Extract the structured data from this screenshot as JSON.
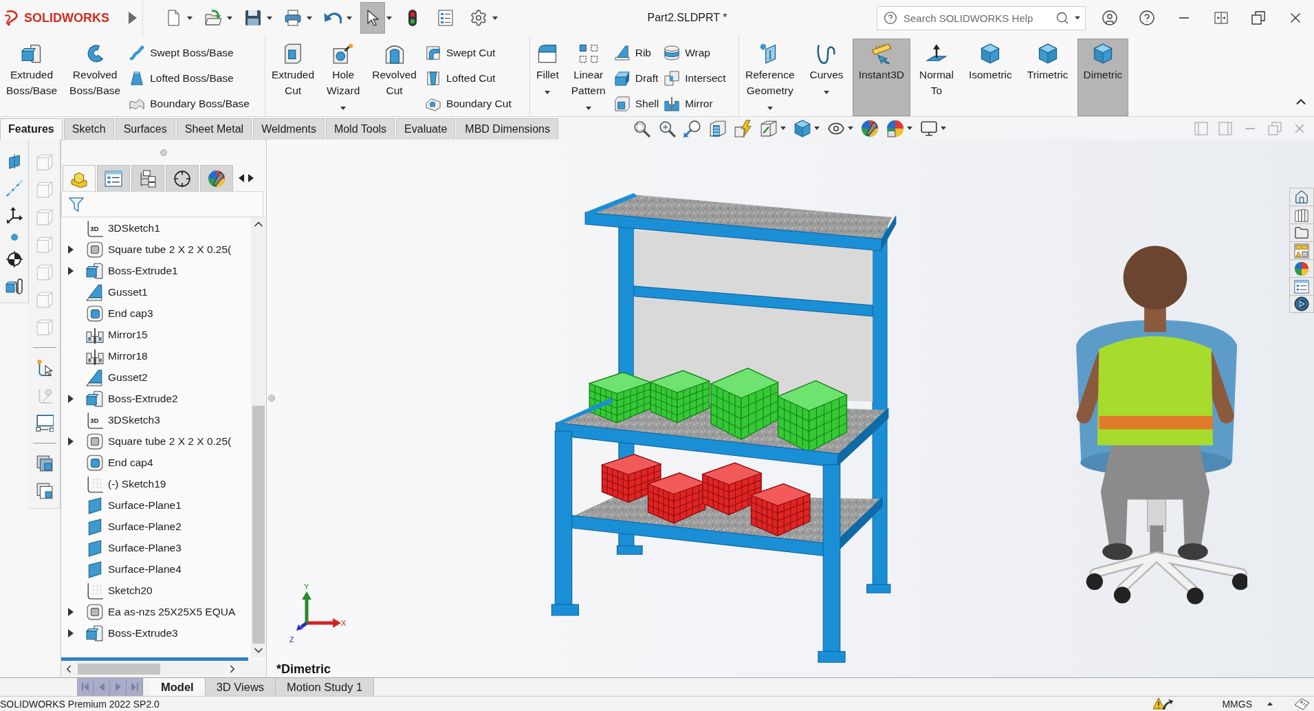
{
  "title_bar": {
    "logo": "SOLIDWORKS",
    "quick_access": [
      {
        "dropdown": true,
        "selected": false
      },
      {
        "dropdown": true,
        "selected": false
      },
      {
        "dropdown": true,
        "selected": false
      },
      {
        "dropdown": true,
        "selected": false
      },
      {
        "dropdown": true,
        "selected": false
      },
      {
        "dropdown": true,
        "selected": true
      },
      {
        "dropdown": false,
        "selected": false
      },
      {
        "dropdown": false,
        "selected": false
      },
      {
        "dropdown": true,
        "selected": false
      }
    ],
    "title": "Part2.SLDPRT *",
    "search": {
      "placeholder": "Search SOLIDWORKS Help"
    }
  },
  "ribbon": {
    "groups": [
      {
        "tools": [
          {
            "kind": "large",
            "label": "Extruded Boss/Base",
            "dropdown": false,
            "selected": false
          },
          {
            "kind": "large",
            "label": "Revolved Boss/Base",
            "dropdown": false,
            "selected": false
          },
          {
            "kind": "stack",
            "items": [
              {
                "label": "Swept Boss/Base"
              },
              {
                "label": "Lofted Boss/Base"
              },
              {
                "label": "Boundary Boss/Base"
              }
            ]
          }
        ]
      },
      {
        "tools": [
          {
            "kind": "large",
            "label": "Extruded Cut",
            "dropdown": false,
            "selected": false
          },
          {
            "kind": "large",
            "label": "Hole Wizard",
            "dropdown": true,
            "selected": false
          },
          {
            "kind": "large",
            "label": "Revolved Cut",
            "dropdown": false,
            "selected": false
          },
          {
            "kind": "stack",
            "items": [
              {
                "label": "Swept Cut"
              },
              {
                "label": "Lofted Cut"
              },
              {
                "label": "Boundary Cut"
              }
            ]
          }
        ]
      },
      {
        "tools": [
          {
            "kind": "large",
            "label": "Fillet",
            "dropdown": true,
            "selected": false
          },
          {
            "kind": "large",
            "label": "Linear Pattern",
            "dropdown": true,
            "selected": false
          },
          {
            "kind": "stack",
            "items": [
              {
                "label": "Rib"
              },
              {
                "label": "Draft"
              },
              {
                "label": "Shell"
              }
            ]
          },
          {
            "kind": "stack",
            "items": [
              {
                "label": "Wrap"
              },
              {
                "label": "Intersect"
              },
              {
                "label": "Mirror"
              }
            ]
          }
        ]
      },
      {
        "tools": [
          {
            "kind": "large",
            "label": "Reference Geometry",
            "dropdown": true,
            "selected": false
          },
          {
            "kind": "large",
            "label": "Curves",
            "dropdown": true,
            "selected": false
          },
          {
            "kind": "large",
            "label": "Instant3D",
            "dropdown": false,
            "selected": true
          },
          {
            "kind": "large",
            "label": "Normal To",
            "dropdown": false,
            "selected": false
          },
          {
            "kind": "large",
            "label": "Isometric",
            "dropdown": false,
            "selected": false
          },
          {
            "kind": "large",
            "label": "Trimetric",
            "dropdown": false,
            "selected": false
          },
          {
            "kind": "large",
            "label": "Dimetric",
            "dropdown": false,
            "selected": true
          }
        ]
      }
    ]
  },
  "command_tabs": [
    {
      "label": "Features",
      "selected": true
    },
    {
      "label": "Sketch",
      "selected": false
    },
    {
      "label": "Surfaces",
      "selected": false
    },
    {
      "label": "Sheet Metal",
      "selected": false
    },
    {
      "label": "Weldments",
      "selected": false
    },
    {
      "label": "Mold Tools",
      "selected": false
    },
    {
      "label": "Evaluate",
      "selected": false
    },
    {
      "label": "MBD Dimensions",
      "selected": false
    }
  ],
  "feature_manager": {
    "tabs": [
      {
        "selected": true
      },
      {
        "selected": false
      },
      {
        "selected": false
      },
      {
        "selected": false
      },
      {
        "selected": false
      }
    ],
    "tree": [
      {
        "kind": "sketch3d",
        "icon_text": "3D",
        "label": "3DSketch1",
        "expandable": false
      },
      {
        "kind": "structure",
        "label": "Square tube 2 X 2 X 0.25(",
        "expandable": true
      },
      {
        "kind": "extrude",
        "label": "Boss-Extrude1",
        "expandable": true
      },
      {
        "kind": "gusset",
        "label": "Gusset1",
        "expandable": false
      },
      {
        "kind": "endcap",
        "label": "End cap3",
        "expandable": false
      },
      {
        "kind": "mirror",
        "label": "Mirror15",
        "expandable": false
      },
      {
        "kind": "mirror",
        "label": "Mirror18",
        "expandable": false
      },
      {
        "kind": "gusset",
        "label": "Gusset2",
        "expandable": false
      },
      {
        "kind": "extrude",
        "label": "Boss-Extrude2",
        "expandable": true
      },
      {
        "kind": "sketch3d",
        "icon_text": "3D",
        "label": "3DSketch3",
        "expandable": false
      },
      {
        "kind": "structure",
        "label": "Square tube 2 X 2 X 0.25(",
        "expandable": true
      },
      {
        "kind": "endcap",
        "label": "End cap4",
        "expandable": false
      },
      {
        "kind": "sketch",
        "label": "(-) Sketch19",
        "expandable": false
      },
      {
        "kind": "surface",
        "label": "Surface-Plane1",
        "expandable": false
      },
      {
        "kind": "surface",
        "label": "Surface-Plane2",
        "expandable": false
      },
      {
        "kind": "surface",
        "label": "Surface-Plane3",
        "expandable": false
      },
      {
        "kind": "surface",
        "label": "Surface-Plane4",
        "expandable": false
      },
      {
        "kind": "sketch",
        "label": "Sketch20",
        "expandable": false
      },
      {
        "kind": "structure",
        "label": "Ea as-nzs 25X25X5 EQUA",
        "expandable": true
      },
      {
        "kind": "extrude",
        "label": "Boss-Extrude3",
        "expandable": true
      }
    ]
  },
  "viewport": {
    "view_label": "*Dimetric",
    "triad": [
      {
        "label": "X"
      },
      {
        "label": "Y"
      },
      {
        "label": "Z"
      }
    ]
  },
  "bottom_tabs": [
    {
      "label": "Model",
      "selected": true
    },
    {
      "label": "3D Views",
      "selected": false
    },
    {
      "label": "Motion Study 1",
      "selected": false
    }
  ],
  "status_bar": {
    "product": "SOLIDWORKS Premium 2022 SP2.0",
    "units": "MMGS"
  }
}
